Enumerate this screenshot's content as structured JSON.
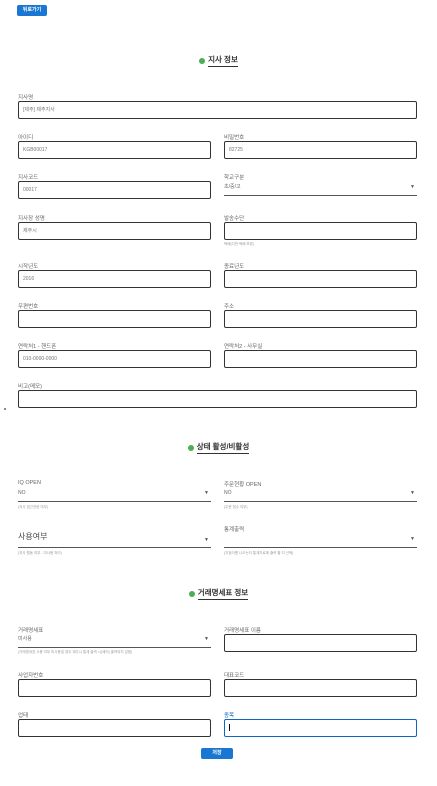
{
  "back_button": "뒤로가기",
  "sections": {
    "branch_info": "지사 정보",
    "status": "상태 활성/비활성",
    "invoice": "거래명세표 정보"
  },
  "fields": {
    "branch_name": {
      "label": "지사명",
      "value": "[제주] 제주지사"
    },
    "user_id": {
      "label": "아이디",
      "value": "KGB00017"
    },
    "password": {
      "label": "비밀번호",
      "value": "82725"
    },
    "branch_code": {
      "label": "지사코드",
      "value": "00017"
    },
    "school_type": {
      "label": "학교구분",
      "value": "초/중/고"
    },
    "manager_name": {
      "label": "지사장 성명",
      "value": "제주시"
    },
    "delivery_method": {
      "label": "발송수단",
      "value": "",
      "hint": "택배(다만 택배 보류)"
    },
    "start_year": {
      "label": "시작년도",
      "value": "2016"
    },
    "end_year": {
      "label": "종료년도",
      "value": ""
    },
    "postal_code": {
      "label": "우편번호",
      "value": ""
    },
    "address": {
      "label": "주소",
      "value": ""
    },
    "phone1": {
      "label": "연락처1 - 핸드폰",
      "value": "010-0000-0000"
    },
    "phone2": {
      "label": "연락처2 - 사무실",
      "value": ""
    },
    "memo": {
      "label": "비고(메모)",
      "value": ""
    },
    "iq_open": {
      "label": "IQ OPEN",
      "value": "NO",
      "hint": "(지사 접근권한 여부)"
    },
    "subscription_open": {
      "label": "주문현황 OPEN",
      "value": "NO",
      "hint": "(주문 접수 여부)"
    },
    "use_status": {
      "label": "",
      "value": "사용여부",
      "hint": "(지사 활동 여부 - 미사용 처리)"
    },
    "stats_output": {
      "label": "통계출력",
      "value": "",
      "hint": "(지점이름 나오는지 통계자료에 출력 할 지 선택)"
    },
    "invoice_type": {
      "label": "거래명세표",
      "value": "미사용",
      "hint": "(거래명세표 사용 여부 미사용일 경우 제주시 통계 출력 시(에러) 출력되지 않음)"
    },
    "invoice_name": {
      "label": "거래명세표 이름",
      "value": ""
    },
    "business_number": {
      "label": "사업자번호",
      "value": ""
    },
    "ceo_name": {
      "label": "대표코드",
      "value": ""
    },
    "company_name": {
      "label": "업태",
      "value": ""
    },
    "business_item": {
      "label": "종목",
      "value": ""
    }
  },
  "save_button": "저장"
}
